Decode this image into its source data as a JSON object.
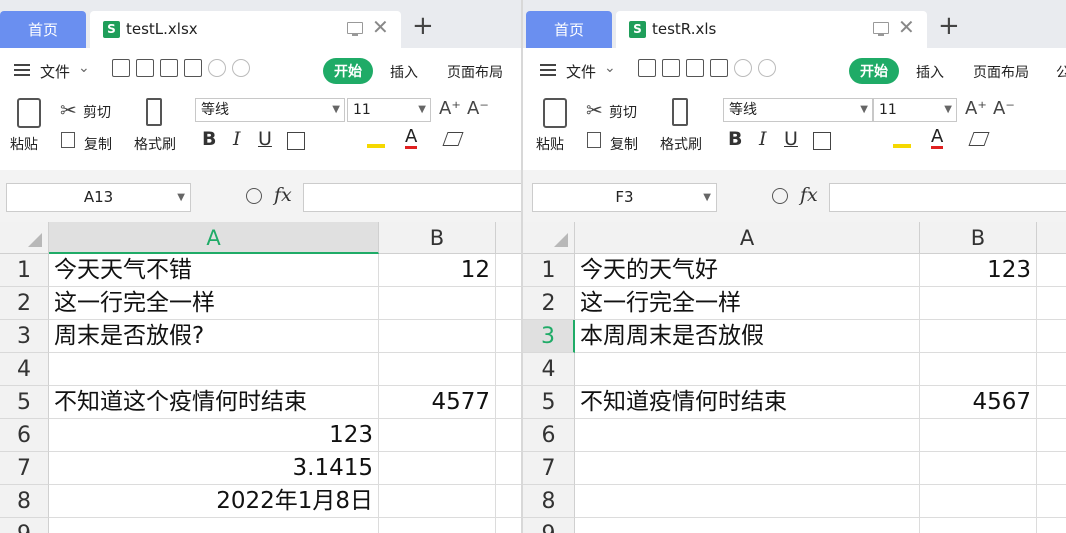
{
  "left": {
    "home_tab": "首页",
    "file_tab": "testL.xlsx",
    "logo_letter": "S",
    "menu_file": "文件",
    "menu_start": "开始",
    "menu_insert": "插入",
    "menu_layout": "页面布局",
    "paste": "粘贴",
    "cut": "剪切",
    "copy": "复制",
    "format_brush": "格式刷",
    "font": "等线",
    "size": "11",
    "cell_ref": "A13",
    "col_a": "A",
    "col_b": "B",
    "rows": [
      {
        "n": "1",
        "a": "今天天气不错",
        "b": "12"
      },
      {
        "n": "2",
        "a": "这一行完全一样",
        "b": ""
      },
      {
        "n": "3",
        "a": "周末是否放假?",
        "b": ""
      },
      {
        "n": "4",
        "a": "",
        "b": ""
      },
      {
        "n": "5",
        "a": "不知道这个疫情何时结束",
        "b": "4577"
      },
      {
        "n": "6",
        "a": "123",
        "b": ""
      },
      {
        "n": "7",
        "a": "3.1415",
        "b": ""
      },
      {
        "n": "8",
        "a": "2022年1月8日",
        "b": ""
      },
      {
        "n": "9",
        "a": "",
        "b": ""
      }
    ]
  },
  "right": {
    "home_tab": "首页",
    "file_tab": "testR.xls",
    "logo_letter": "S",
    "menu_file": "文件",
    "menu_start": "开始",
    "menu_insert": "插入",
    "menu_layout": "页面布局",
    "menu_extra": "公",
    "paste": "粘贴",
    "cut": "剪切",
    "copy": "复制",
    "format_brush": "格式刷",
    "font": "等线",
    "size": "11",
    "cell_ref": "F3",
    "col_a": "A",
    "col_b": "B",
    "rows": [
      {
        "n": "1",
        "a": "今天的天气好",
        "b": "123"
      },
      {
        "n": "2",
        "a": "这一行完全一样",
        "b": ""
      },
      {
        "n": "3",
        "a": "本周周末是否放假",
        "b": ""
      },
      {
        "n": "4",
        "a": "",
        "b": ""
      },
      {
        "n": "5",
        "a": "不知道疫情何时结束",
        "b": "4567"
      },
      {
        "n": "6",
        "a": "",
        "b": ""
      },
      {
        "n": "7",
        "a": "",
        "b": ""
      },
      {
        "n": "8",
        "a": "",
        "b": ""
      },
      {
        "n": "9",
        "a": "",
        "b": ""
      }
    ]
  },
  "colors": {
    "accent": "#1fab67",
    "home_tab": "#6a8ff0"
  },
  "formatting": {
    "bold": "B",
    "italic": "I",
    "underline": "U",
    "font_color": "A",
    "grow": "A⁺",
    "shrink": "A⁻",
    "fx": "fx"
  }
}
